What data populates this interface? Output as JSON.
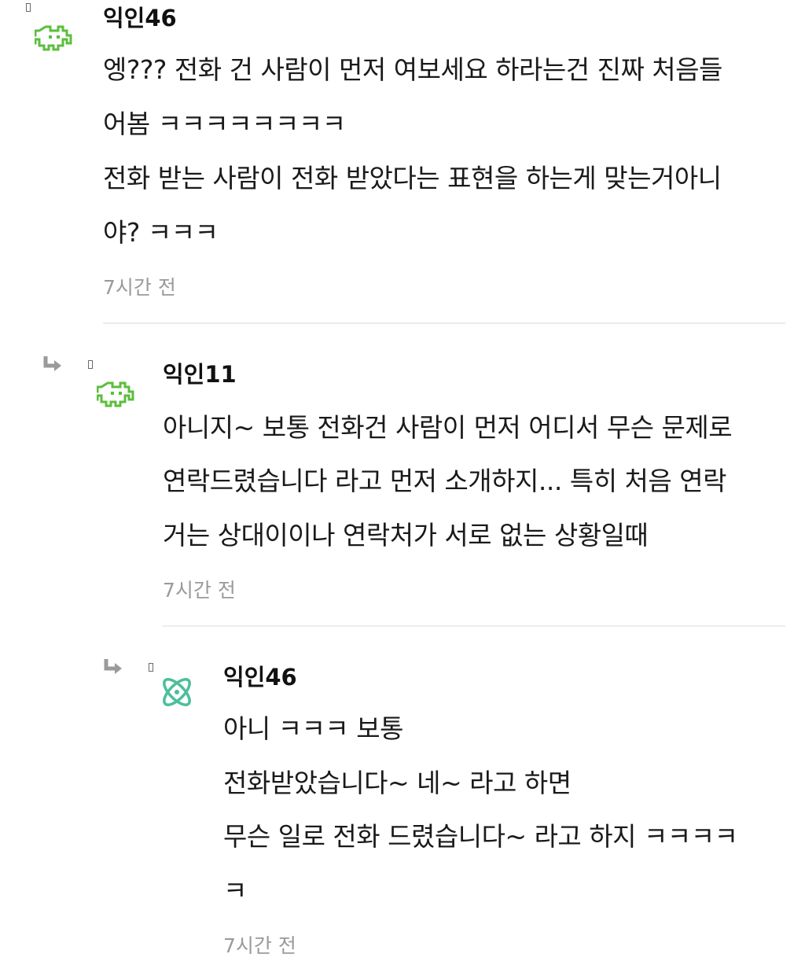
{
  "comments": [
    {
      "author": "익인46",
      "avatar_icon": "pixel-invader-icon",
      "avatar_color": "#5cbe3c",
      "lines": [
        "엥??? 전화 건 사람이 먼저 여보세요 하라는건 진짜 처음들",
        "어봄 ㅋㅋㅋㅋㅋㅋㅋㅋ",
        "전화 받는 사람이 전화 받았다는 표현을 하는게 맞는거아니",
        "야? ㅋㅋㅋ"
      ],
      "time": "7시간 전"
    },
    {
      "author": "익인11",
      "avatar_icon": "pixel-invader-icon",
      "avatar_color": "#5cbe3c",
      "lines": [
        "아니지~ 보통 전화건 사람이 먼저 어디서 무슨 문제로",
        "연락드렸습니다 라고 먼저 소개하지... 특히 처음 연락",
        "거는 상대이이나 연락처가 서로 없는 상황일때"
      ],
      "time": "7시간 전"
    },
    {
      "author": "익인46",
      "avatar_icon": "atom-icon",
      "avatar_color": "#4bbf9a",
      "lines": [
        "아니 ㅋㅋㅋ 보통",
        "전화받았습니다~ 네~ 라고 하면",
        "무슨 일로 전화 드렸습니다~ 라고 하지 ㅋㅋㅋㅋ",
        "ㅋ"
      ],
      "time": "7시간 전"
    }
  ],
  "colors": {
    "reply_arrow": "#9a9a9a",
    "divider": "#ececec",
    "time": "#9a9a9a"
  }
}
